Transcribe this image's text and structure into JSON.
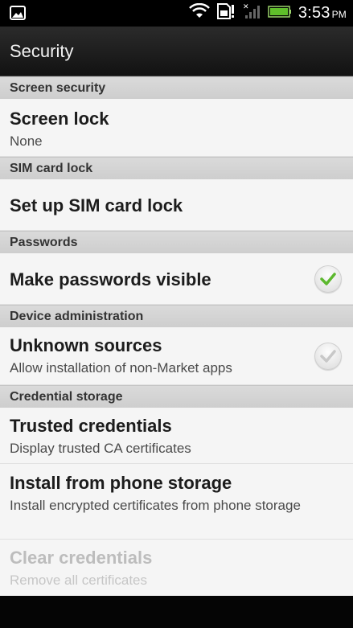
{
  "status_bar": {
    "time": "3:53",
    "ampm": "PM",
    "icons": [
      "gallery-icon",
      "wifi-icon",
      "sim-alert-icon",
      "signal-icon",
      "battery-icon"
    ]
  },
  "header": {
    "title": "Security"
  },
  "sections": {
    "screen_security": {
      "title": "Screen security",
      "screen_lock": {
        "label": "Screen lock",
        "summary": "None"
      }
    },
    "sim_card_lock": {
      "title": "SIM card lock",
      "setup": {
        "label": "Set up SIM card lock"
      }
    },
    "passwords": {
      "title": "Passwords",
      "visible": {
        "label": "Make passwords visible",
        "checked": true
      }
    },
    "device_admin": {
      "title": "Device administration",
      "unknown_sources": {
        "label": "Unknown sources",
        "summary": "Allow installation of non-Market apps",
        "checked": false
      }
    },
    "credential_storage": {
      "title": "Credential storage",
      "trusted": {
        "label": "Trusted credentials",
        "summary": "Display trusted CA certificates"
      },
      "install": {
        "label": "Install from phone storage",
        "summary": "Install encrypted certificates from phone storage"
      },
      "clear": {
        "label": "Clear credentials",
        "summary": "Remove all certificates",
        "enabled": false
      }
    }
  },
  "colors": {
    "check_green": "#5cb82e",
    "check_grey": "#c8c8c8"
  }
}
